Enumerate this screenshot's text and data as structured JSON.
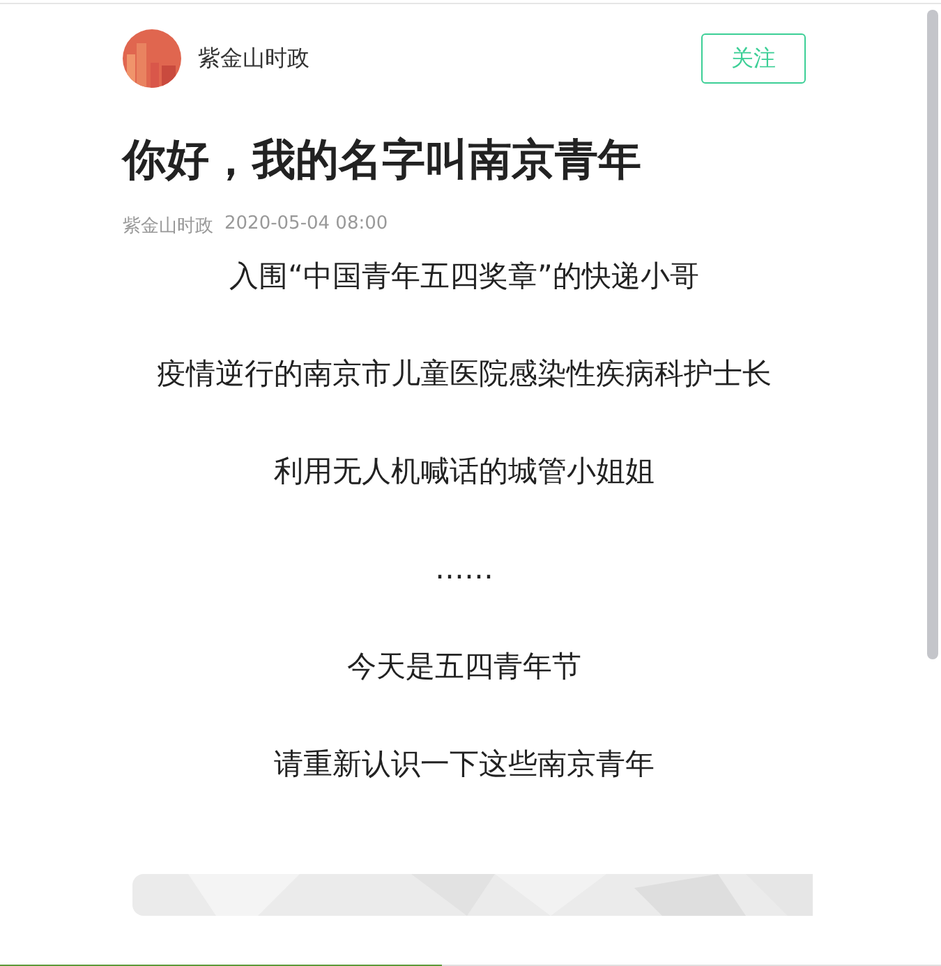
{
  "account": {
    "name": "紫金山时政",
    "follow_button": "关注"
  },
  "article": {
    "title": "你好，我的名字叫南京青年",
    "source": "紫金山时政",
    "date": "2020-05-04 08:00",
    "paragraphs": [
      "入围“中国青年五四奖章”的快递小哥",
      "疫情逆行的南京市儿童医院感染性疾病科护士长",
      "利用无人机喊话的城管小姐姐",
      "……",
      "今天是五四青年节",
      "请重新认识一下这些南京青年"
    ]
  },
  "reading_progress": {
    "level": 0.47
  }
}
